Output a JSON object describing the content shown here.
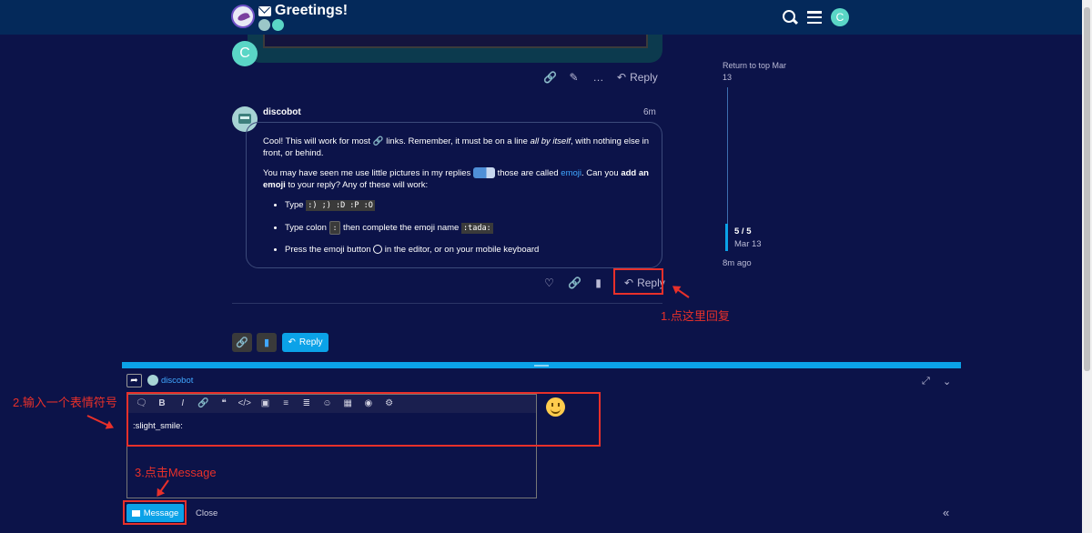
{
  "header": {
    "topic_title": "Greetings!",
    "avatar_letter": "C"
  },
  "previous_post": {
    "avatar_letter": "C",
    "reply_label": "Reply"
  },
  "post": {
    "username": "discobot",
    "time": "6m",
    "para1_a": "Cool! This will work for most ",
    "para1_b": " links. Remember, it must be on a line ",
    "para1_em": "all by itself",
    "para1_c": ", with nothing else in front, or behind.",
    "para2_a": "You may have seen me use little pictures in my replies ",
    "para2_b": " those are called ",
    "para2_link": "emoji",
    "para2_c": ". Can you ",
    "para2_strong1": "add an emoji",
    "para2_d": " to your reply? Any of these will work:",
    "bullet1_a": "Type ",
    "bullet1_code": ":) ;) :D :P :O",
    "bullet2_a": "Type colon ",
    "bullet2_kbd": ":",
    "bullet2_b": " then complete the emoji name ",
    "bullet2_code": ":tada:",
    "bullet3_a": "Press the emoji button ",
    "bullet3_b": " in the editor, or on your mobile keyboard",
    "reply_label": "Reply"
  },
  "annotations": {
    "step1": "1.点这里回复",
    "step2": "2.输入一个表情符号",
    "step3": "3.点击Message"
  },
  "bottom_buttons": {
    "reply_label": "Reply"
  },
  "timeline": {
    "top_label": "Return to top Mar 13",
    "count": "5 / 5",
    "date": "Mar 13",
    "ago": "8m ago"
  },
  "composer": {
    "recipient": "discobot",
    "editor_text": ":slight_smile:",
    "message_label": "Message",
    "close_label": "Close"
  },
  "icons": {
    "toolbar": [
      "quote-icon",
      "bold-icon",
      "italic-icon",
      "link-icon",
      "blockquote-icon",
      "code-icon",
      "image-icon",
      "bullet-list-icon",
      "numbered-list-icon",
      "emoji-icon",
      "calendar-icon",
      "palette-icon",
      "gear-icon"
    ]
  },
  "colors": {
    "accent": "#0ba2e8",
    "header_bg": "#04295a",
    "page_bg": "#0c1349",
    "annotation": "#e8302a"
  }
}
